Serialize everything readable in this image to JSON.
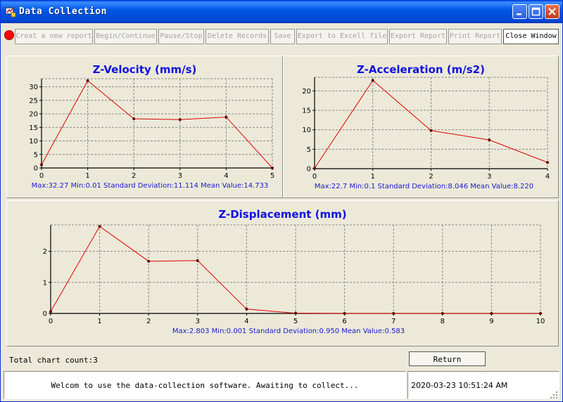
{
  "window": {
    "title": "Data Collection"
  },
  "toolbar": {
    "buttons": [
      "Creat a new report",
      "Begin/Continue",
      "Pause/Stop",
      "Delete Records",
      "Save",
      "Export to Excell file",
      "Export Report",
      "Print Report",
      "Close Window"
    ]
  },
  "colors": {
    "title": "#1010e0",
    "stats": "#1a1ad0",
    "line": "#e00000",
    "point": "#600000",
    "panel": "#ece9d8"
  },
  "chart_data": [
    {
      "type": "line",
      "title": "Z-Velocity (mm/s)",
      "x": [
        0,
        1,
        2,
        3,
        4,
        5
      ],
      "values": [
        1.2,
        32.27,
        18.2,
        17.9,
        18.8,
        0.01
      ],
      "xlim": [
        0,
        5
      ],
      "ylim": [
        0,
        33
      ],
      "yticks": [
        0,
        5,
        10,
        15,
        20,
        25,
        30
      ],
      "grid": true,
      "stats": "Max:32.27  Min:0.01 Standard Deviation:11.114 Mean Value:14.733"
    },
    {
      "type": "line",
      "title": "Z-Acceleration (m/s2)",
      "x": [
        0,
        1,
        2,
        3,
        4
      ],
      "values": [
        0.1,
        22.7,
        9.8,
        7.4,
        1.6
      ],
      "xlim": [
        0,
        4
      ],
      "ylim": [
        0,
        23.5
      ],
      "yticks": [
        0,
        5,
        10,
        15,
        20
      ],
      "grid": true,
      "stats": "Max:22.7  Min:0.1 Standard Deviation:8.046 Mean Value:8.220"
    },
    {
      "type": "line",
      "title": "Z-Displacement (mm)",
      "x": [
        0,
        1,
        2,
        3,
        4,
        5,
        6,
        7,
        8,
        9,
        10
      ],
      "values": [
        0.06,
        2.803,
        1.68,
        1.7,
        0.14,
        0.01,
        0.001,
        0.001,
        0.001,
        0.001,
        0.001
      ],
      "xlim": [
        0,
        10
      ],
      "ylim": [
        0,
        2.85
      ],
      "yticks": [
        0,
        1,
        2
      ],
      "grid": true,
      "stats": "Max:2.803  Min:0.001 Standard Deviation:0.950 Mean Value:0.583"
    }
  ],
  "footer": {
    "count_text": "Total chart count:3",
    "return_label": "Return",
    "message": "Welcom to use the data-collection software. Awaiting to collect...",
    "timestamp": "2020-03-23 10:51:24 AM"
  }
}
